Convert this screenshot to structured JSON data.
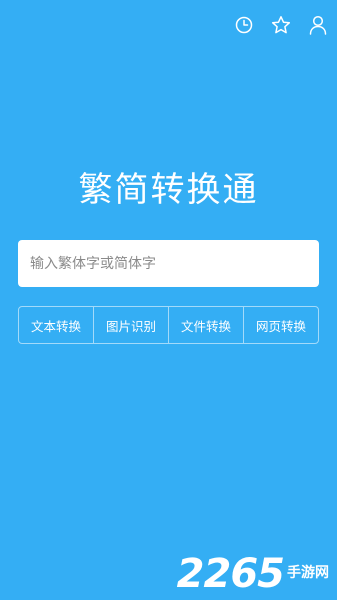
{
  "colors": {
    "background": "#34aef4",
    "text": "#ffffff",
    "input_background": "#ffffff",
    "placeholder": "#8a8a8a"
  },
  "header": {
    "icons": [
      "history-icon",
      "favorite-star-icon",
      "user-profile-icon"
    ]
  },
  "app": {
    "title": "繁简转换通"
  },
  "search": {
    "placeholder": "输入繁体字或简体字",
    "value": ""
  },
  "tabs": [
    {
      "label": "文本转换"
    },
    {
      "label": "图片识别"
    },
    {
      "label": "文件转换"
    },
    {
      "label": "网页转换"
    }
  ],
  "watermark": {
    "number": "2265",
    "text": "手游网"
  }
}
